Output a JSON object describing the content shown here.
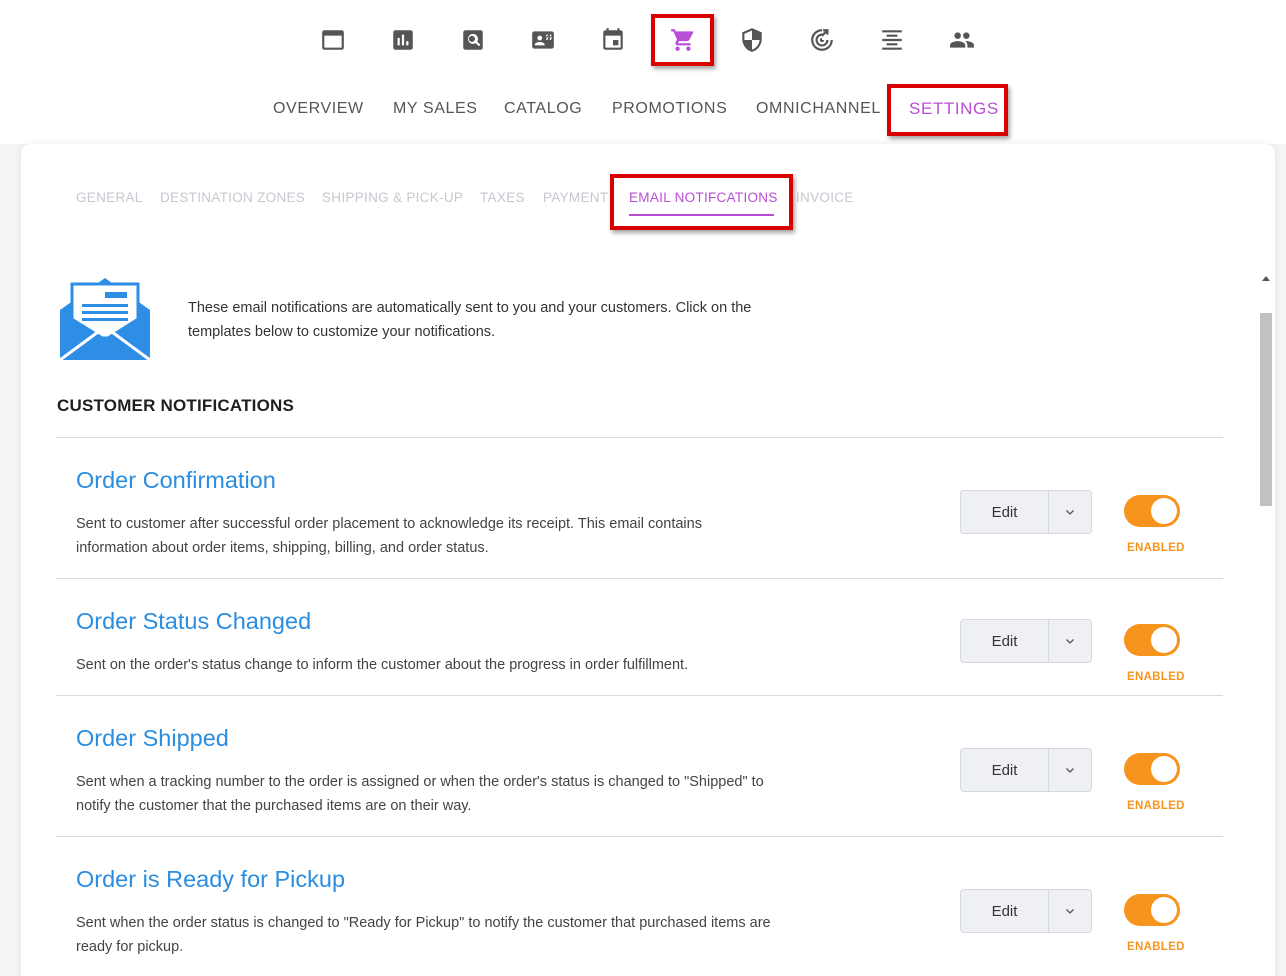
{
  "top_icons": [
    {
      "name": "window-icon",
      "active": false
    },
    {
      "name": "bar-chart-icon",
      "active": false
    },
    {
      "name": "search-icon",
      "active": false
    },
    {
      "name": "contact-card-icon",
      "active": false
    },
    {
      "name": "calendar-icon",
      "active": false
    },
    {
      "name": "shopping-cart-icon",
      "active": true
    },
    {
      "name": "shield-icon",
      "active": false
    },
    {
      "name": "radar-icon",
      "active": false
    },
    {
      "name": "align-center-icon",
      "active": false
    },
    {
      "name": "people-icon",
      "active": false
    }
  ],
  "main_nav": {
    "overview": "OVERVIEW",
    "my_sales": "MY SALES",
    "catalog": "CATALOG",
    "promotions": "PROMOTIONS",
    "omnichannel": "OMNICHANNEL",
    "settings": "SETTINGS",
    "active": "SETTINGS"
  },
  "sub_tabs": {
    "general": "GENERAL",
    "destination_zones": "DESTINATION ZONES",
    "shipping": "SHIPPING & PICK-UP",
    "taxes": "TAXES",
    "payment": "PAYMENT",
    "email_notifications": "EMAIL NOTIFCATIONS",
    "invoice": "INVOICE",
    "active": "EMAIL NOTIFCATIONS"
  },
  "intro": {
    "icon": "envelope-icon",
    "text": "These email notifications are automatically sent to you and your customers. Click on the templates below to customize your notifications."
  },
  "section_title": "CUSTOMER NOTIFICATIONS",
  "notifications": [
    {
      "title": "Order Confirmation",
      "description": "Sent to customer after successful order placement to acknowledge its receipt. This email contains information about order items, shipping, billing, and order status.",
      "edit_label": "Edit",
      "enabled": true,
      "status_label": "ENABLED"
    },
    {
      "title": "Order Status Changed",
      "description": "Sent on the order's status change to inform the customer about the progress in order fulfillment.",
      "edit_label": "Edit",
      "enabled": true,
      "status_label": "ENABLED"
    },
    {
      "title": "Order Shipped",
      "description": "Sent when a tracking number to the order is assigned or when the order's status is changed to \"Shipped\" to notify the customer that the purchased items are on their way.",
      "edit_label": "Edit",
      "enabled": true,
      "status_label": "ENABLED"
    },
    {
      "title": "Order is Ready for Pickup",
      "description": "Sent when the order status is changed to \"Ready for Pickup\" to notify the customer that purchased items are ready for pickup.",
      "edit_label": "Edit",
      "enabled": true,
      "status_label": "ENABLED"
    }
  ],
  "colors": {
    "accent": "#b84dd6",
    "link": "#2a8de0",
    "toggle_on": "#f7941d",
    "highlight": "#d80000"
  }
}
